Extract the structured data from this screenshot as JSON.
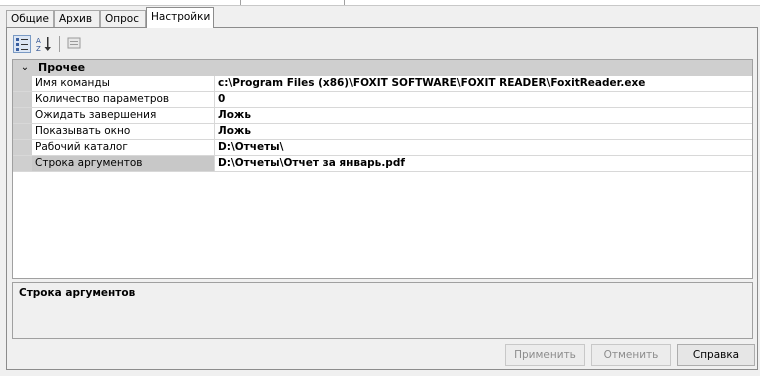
{
  "tabs": [
    {
      "label": "Общие"
    },
    {
      "label": "Архив"
    },
    {
      "label": "Опрос"
    },
    {
      "label": "Настройки"
    }
  ],
  "toolbar": {
    "icons": [
      "categorized-view-icon",
      "alphabetical-sort-icon",
      "property-pages-icon"
    ]
  },
  "grid": {
    "category": {
      "label": "Прочее",
      "toggle": "⌄"
    },
    "rows": [
      {
        "name": "Имя команды",
        "value": "c:\\Program Files (x86)\\FOXIT SOFTWARE\\FOXIT READER\\FoxitReader.exe"
      },
      {
        "name": "Количество параметров",
        "value": "0"
      },
      {
        "name": "Ожидать завершения",
        "value": "Ложь"
      },
      {
        "name": "Показывать окно",
        "value": "Ложь"
      },
      {
        "name": "Рабочий каталог",
        "value": "D:\\Отчеты\\"
      },
      {
        "name": "Строка аргументов",
        "value": "D:\\Отчеты\\Отчет за январь.pdf"
      }
    ]
  },
  "description": {
    "title": "Строка аргументов"
  },
  "buttons": {
    "apply": "Применить",
    "cancel": "Отменить",
    "help": "Справка"
  }
}
